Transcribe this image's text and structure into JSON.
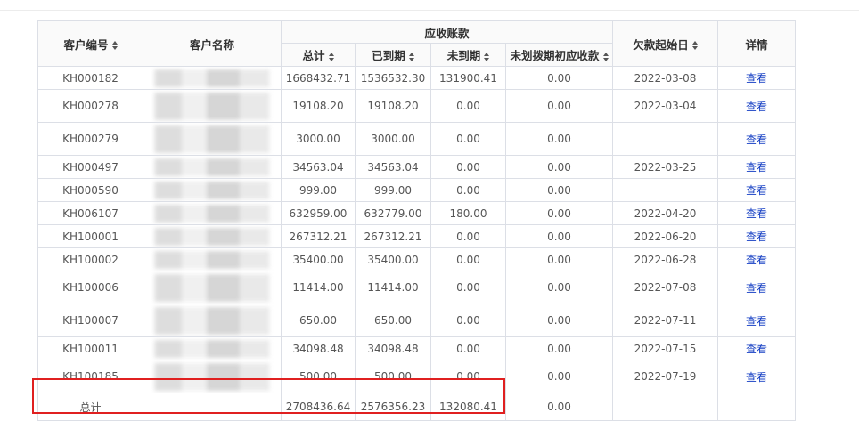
{
  "table": {
    "headers": {
      "code": "客户编号",
      "name": "客户名称",
      "group": "应收账款",
      "total": "总计",
      "due": "已到期",
      "not_due": "未到期",
      "unbilled": "未划拨期初应收款",
      "start_date": "欠款起始日",
      "detail": "详情"
    },
    "rows": [
      {
        "code": "KH000182",
        "total": "1668432.71",
        "due": "1536532.30",
        "not_due": "131900.41",
        "unbilled": "0.00",
        "date": "2022-03-08",
        "detail": "查看"
      },
      {
        "code": "KH000278",
        "total": "19108.20",
        "due": "19108.20",
        "not_due": "0.00",
        "unbilled": "0.00",
        "date": "2022-03-04",
        "detail": "查看"
      },
      {
        "code": "KH000279",
        "total": "3000.00",
        "due": "3000.00",
        "not_due": "0.00",
        "unbilled": "0.00",
        "date": "",
        "detail": "查看"
      },
      {
        "code": "KH000497",
        "total": "34563.04",
        "due": "34563.04",
        "not_due": "0.00",
        "unbilled": "0.00",
        "date": "2022-03-25",
        "detail": "查看"
      },
      {
        "code": "KH000590",
        "total": "999.00",
        "due": "999.00",
        "not_due": "0.00",
        "unbilled": "0.00",
        "date": "",
        "detail": "查看"
      },
      {
        "code": "KH006107",
        "total": "632959.00",
        "due": "632779.00",
        "not_due": "180.00",
        "unbilled": "0.00",
        "date": "2022-04-20",
        "detail": "查看"
      },
      {
        "code": "KH100001",
        "total": "267312.21",
        "due": "267312.21",
        "not_due": "0.00",
        "unbilled": "0.00",
        "date": "2022-06-20",
        "detail": "查看"
      },
      {
        "code": "KH100002",
        "total": "35400.00",
        "due": "35400.00",
        "not_due": "0.00",
        "unbilled": "0.00",
        "date": "2022-06-28",
        "detail": "查看"
      },
      {
        "code": "KH100006",
        "total": "11414.00",
        "due": "11414.00",
        "not_due": "0.00",
        "unbilled": "0.00",
        "date": "2022-07-08",
        "detail": "查看"
      },
      {
        "code": "KH100007",
        "total": "650.00",
        "due": "650.00",
        "not_due": "0.00",
        "unbilled": "0.00",
        "date": "2022-07-11",
        "detail": "查看"
      },
      {
        "code": "KH100011",
        "total": "34098.48",
        "due": "34098.48",
        "not_due": "0.00",
        "unbilled": "0.00",
        "date": "2022-07-15",
        "detail": "查看"
      },
      {
        "code": "KH100185",
        "total": "500.00",
        "due": "500.00",
        "not_due": "0.00",
        "unbilled": "0.00",
        "date": "2022-07-19",
        "detail": "查看"
      }
    ],
    "footer": {
      "label": "总计",
      "total": "2708436.64",
      "due": "2576356.23",
      "not_due": "132080.41",
      "unbilled": "0.00"
    }
  },
  "colors": {
    "link": "#1740c4",
    "highlight_box": "#e02020",
    "border": "#dcdfe6"
  }
}
